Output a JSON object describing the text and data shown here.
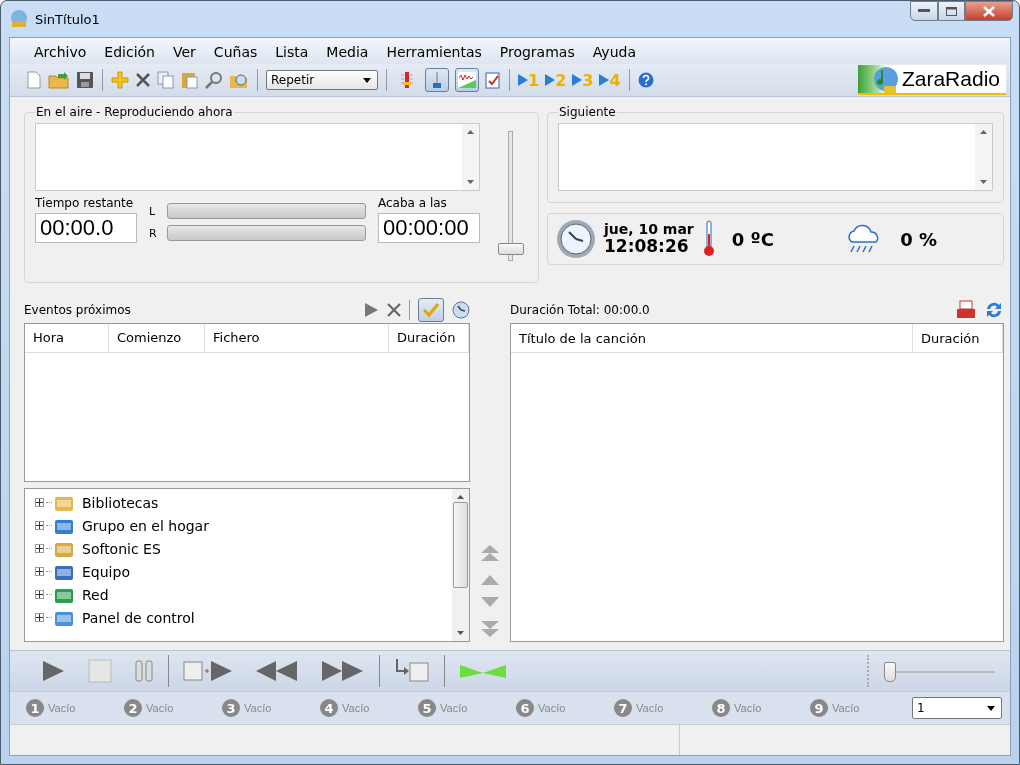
{
  "window": {
    "title": "SinTítulo1"
  },
  "menu": [
    "Archivo",
    "Edición",
    "Ver",
    "Cuñas",
    "Lista",
    "Media",
    "Herramientas",
    "Programas",
    "Ayuda"
  ],
  "toolbar": {
    "mode_dropdown": "Repetir",
    "toggles": [
      {
        "kind": "meter",
        "selected": false
      },
      {
        "kind": "slider",
        "selected": true
      },
      {
        "kind": "wave",
        "selected": true
      }
    ],
    "quick_slots": [
      "1",
      "2",
      "3",
      "4"
    ],
    "logo_text": "ZaraRadio"
  },
  "on_air": {
    "title": "En el aire - Reproduciendo ahora",
    "time_remaining_label": "Tiempo restante",
    "time_remaining": "00:00.0",
    "channels": [
      {
        "name": "L"
      },
      {
        "name": "R"
      }
    ],
    "ends_at_label": "Acaba a las",
    "ends_at": "00:00:00",
    "volume": {
      "level": 0.05
    }
  },
  "next": {
    "title": "Siguiente"
  },
  "status": {
    "date": "jue, 10 mar",
    "time": "12:08:26",
    "temperature": "0 ºC",
    "rain": "0 %"
  },
  "events": {
    "title": "Eventos próximos",
    "enabled": true,
    "columns": [
      "Hora",
      "Comienzo",
      "Fichero",
      "Duración"
    ]
  },
  "explorer": {
    "items": [
      {
        "label": "Bibliotecas",
        "expanded": false
      },
      {
        "label": "Grupo en el hogar",
        "expanded": false
      },
      {
        "label": "Softonic ES",
        "expanded": false
      },
      {
        "label": "Equipo",
        "expanded": false
      },
      {
        "label": "Red",
        "expanded": false
      },
      {
        "label": "Panel de control",
        "expanded": false
      }
    ]
  },
  "playlist": {
    "total": "Duración Total: 00:00.0",
    "columns": [
      "Título de la canción",
      "Duración"
    ]
  },
  "transport": {
    "position": {
      "level": 0
    }
  },
  "carts": {
    "slots": [
      {
        "number": "1",
        "label": "Vacío"
      },
      {
        "number": "2",
        "label": "Vacío"
      },
      {
        "number": "3",
        "label": "Vacío"
      },
      {
        "number": "4",
        "label": "Vacío"
      },
      {
        "number": "5",
        "label": "Vacío"
      },
      {
        "number": "6",
        "label": "Vacío"
      },
      {
        "number": "7",
        "label": "Vacío"
      },
      {
        "number": "8",
        "label": "Vacío"
      },
      {
        "number": "9",
        "label": "Vacío"
      }
    ],
    "page": "1"
  }
}
